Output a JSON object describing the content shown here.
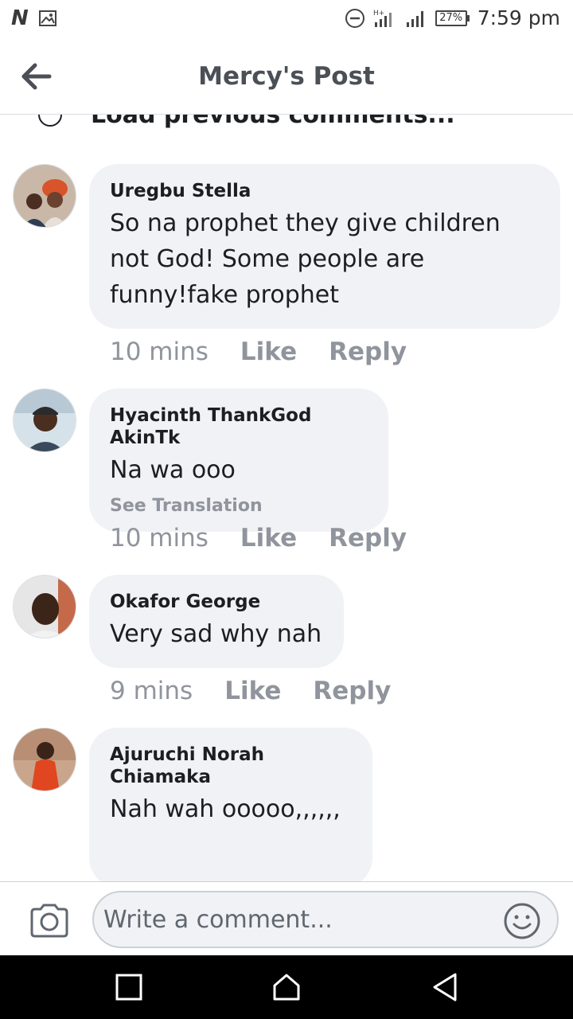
{
  "status_bar": {
    "left_icons": [
      "n-app-icon",
      "image-icon"
    ],
    "battery": "27%",
    "time": "7:59 pm"
  },
  "header": {
    "title": "Mercy's Post"
  },
  "feed": {
    "load_previous": "Load previous comments...",
    "comments": [
      {
        "author": "Uregbu Stella",
        "text": "So na prophet they give children not God! Some people are funny!fake prophet",
        "time": "10 mins",
        "like": "Like",
        "reply": "Reply"
      },
      {
        "author": "Hyacinth ThankGod AkinTk",
        "text": "Na wa ooo",
        "see_translation": "See Translation",
        "time": "10 mins",
        "like": "Like",
        "reply": "Reply"
      },
      {
        "author": "Okafor George",
        "text": "Very sad why nah",
        "time": "9 mins",
        "like": "Like",
        "reply": "Reply"
      },
      {
        "author": "Ajuruchi Norah Chiamaka",
        "text": "Nah wah ooooo,,,,,,"
      }
    ]
  },
  "composer": {
    "placeholder": "Write a comment..."
  },
  "colors": {
    "bubble": "#f0f2f5",
    "secondary_text": "#90949c",
    "title_text": "#4b4f56"
  }
}
